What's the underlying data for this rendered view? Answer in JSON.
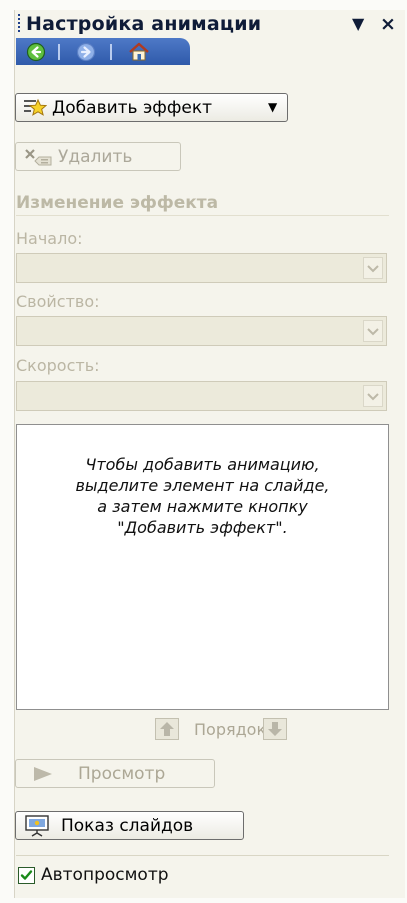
{
  "panel": {
    "title": "Настройка анимации",
    "menu_glyph": "▼",
    "close_glyph": "×"
  },
  "nav": {
    "icons": [
      "back-icon",
      "forward-icon",
      "home-icon"
    ]
  },
  "add_effect": {
    "label": "Добавить эффект",
    "dropdown_glyph": "▼"
  },
  "delete": {
    "label": "Удалить",
    "enabled": false
  },
  "section_title": "Изменение эффекта",
  "fields": {
    "start_label": "Начало:",
    "start_value": "",
    "property_label": "Свойство:",
    "property_value": "",
    "speed_label": "Скорость:",
    "speed_value": ""
  },
  "effects_list": {
    "hint": "Чтобы добавить анимацию,\nвыделите элемент на слайде,\nа затем нажмите кнопку\n\"Добавить эффект\"."
  },
  "order": {
    "label": "Порядок"
  },
  "preview": {
    "label": "Просмотр",
    "enabled": false
  },
  "slideshow": {
    "label": "Показ слайдов"
  },
  "autopreview": {
    "label": "Автопросмотр",
    "checked": true
  },
  "colors": {
    "nav_bar": "#2f5aaa",
    "title_text": "#0f1c38",
    "disabled_text": "#b2ad99",
    "checkbox_mark": "#1a8a1a"
  }
}
